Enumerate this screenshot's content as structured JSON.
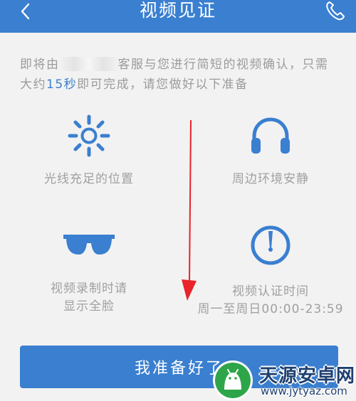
{
  "header": {
    "title": "视频见证",
    "back_icon": "chevron-left-icon",
    "call_icon": "phone-icon"
  },
  "intro": {
    "part1": "即将由",
    "part2": "客服与您进行简短的视频确认，只需大约",
    "highlight": "15秒",
    "part3": "即可完成，请您做好以下准备"
  },
  "features": [
    {
      "icon": "sun-icon",
      "lines": [
        "光线充足的位置"
      ]
    },
    {
      "icon": "headphones-icon",
      "lines": [
        "周边环境安静"
      ]
    },
    {
      "icon": "sunglasses-icon",
      "lines": [
        "视频录制时请",
        "显示全脸"
      ]
    },
    {
      "icon": "clock-icon",
      "lines": [
        "视频认证时间",
        "周一至周日00:00-23:59"
      ]
    }
  ],
  "ready_button": {
    "label": "我准备好了"
  },
  "watermark": {
    "title": "天源安卓网",
    "url": "www.jytyaz.com"
  },
  "colors": {
    "primary": "#3a7fd0",
    "background": "#f2f2f2",
    "text_gray": "#9b9b9b",
    "arrow": "#e8232a"
  }
}
